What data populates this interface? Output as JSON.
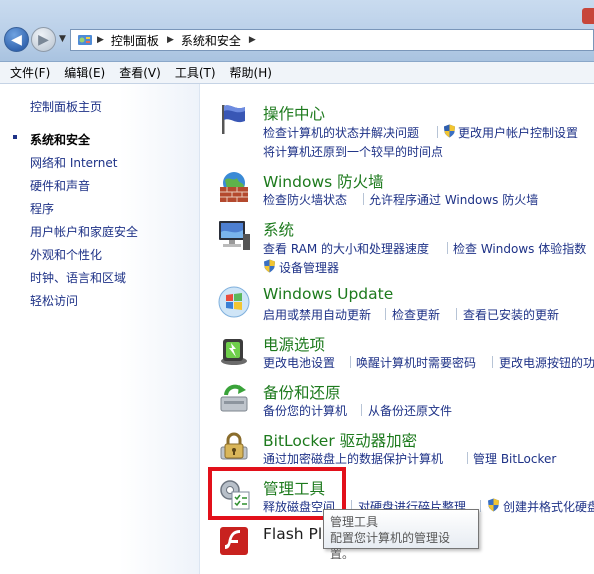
{
  "address_bar": {
    "breadcrumbs": [
      "控制面板",
      "系统和安全"
    ]
  },
  "menu": [
    "文件(F)",
    "编辑(E)",
    "查看(V)",
    "工具(T)",
    "帮助(H)"
  ],
  "sidebar": {
    "items": [
      {
        "label": "控制面板主页",
        "current": false
      },
      {
        "label": "系统和安全",
        "current": true
      },
      {
        "label": "网络和 Internet",
        "current": false
      },
      {
        "label": "硬件和声音",
        "current": false
      },
      {
        "label": "程序",
        "current": false
      },
      {
        "label": "用户帐户和家庭安全",
        "current": false
      },
      {
        "label": "外观和个性化",
        "current": false
      },
      {
        "label": "时钟、语言和区域",
        "current": false
      },
      {
        "label": "轻松访问",
        "current": false
      }
    ]
  },
  "categories": [
    {
      "title": "操作中心",
      "icon": "flag-icon",
      "links": [
        "检查计算机的状态并解决问题",
        "更改用户帐户控制设置",
        "将计算机还原到一个较早的时间点"
      ]
    },
    {
      "title": "Windows 防火墙",
      "icon": "firewall-icon",
      "links": [
        "检查防火墙状态",
        "允许程序通过 Windows 防火墙"
      ]
    },
    {
      "title": "系统",
      "icon": "computer-icon",
      "links": [
        "查看 RAM 的大小和处理器速度",
        "检查 Windows 体验指数",
        "设备管理器"
      ]
    },
    {
      "title": "Windows Update",
      "icon": "windows-update-icon",
      "links": [
        "启用或禁用自动更新",
        "检查更新",
        "查看已安装的更新"
      ]
    },
    {
      "title": "电源选项",
      "icon": "battery-icon",
      "links": [
        "更改电池设置",
        "唤醒计算机时需要密码",
        "更改电源按钮的功"
      ]
    },
    {
      "title": "备份和还原",
      "icon": "backup-icon",
      "links": [
        "备份您的计算机",
        "从备份还原文件"
      ]
    },
    {
      "title": "BitLocker 驱动器加密",
      "icon": "bitlocker-icon",
      "links": [
        "通过加密磁盘上的数据保护计算机",
        "管理 BitLocker"
      ]
    },
    {
      "title": "管理工具",
      "icon": "admin-tools-icon",
      "links": [
        "释放磁盘空间",
        "对硬盘进行碎片整理",
        "创建并格式化硬盘"
      ]
    },
    {
      "title": "Flash Pla",
      "icon": "flash-icon",
      "links": []
    }
  ],
  "tooltip": {
    "title": "管理工具",
    "text": "配置您计算机的管理设置。"
  }
}
